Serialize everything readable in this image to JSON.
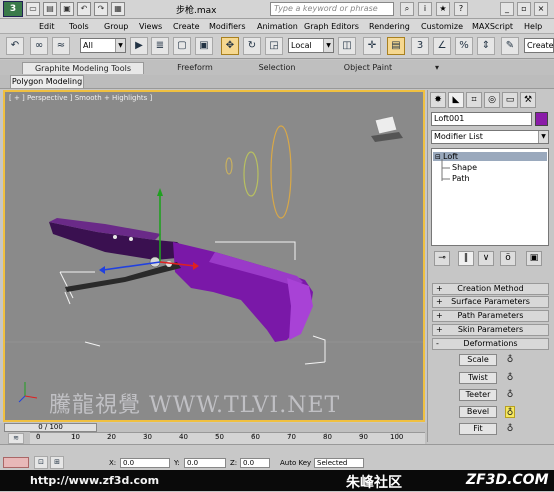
{
  "title_bar": {
    "document_title": "步枪.max",
    "search_placeholder": "Type a keyword or phrase"
  },
  "menu": [
    "Edit",
    "Tools",
    "Group",
    "Views",
    "Create",
    "Modifiers",
    "Animation",
    "Graph Editors",
    "Rendering",
    "Customize",
    "MAXScript",
    "Help"
  ],
  "toolbar": {
    "selection_filter": "All",
    "reference_coord": "Local",
    "named_selection_label": "Create"
  },
  "ribbon": {
    "tabs": [
      "Graphite Modeling Tools",
      "Freeform",
      "Selection",
      "Object Paint"
    ],
    "panel_tab": "Polygon Modeling"
  },
  "viewport": {
    "label": "[ + ] Perspective ] Smooth + Highlights ]",
    "watermark": "騰龍視覺 WWW.TLVI.NET"
  },
  "command_panel": {
    "object_name": "Loft001",
    "object_color": "#8a1ca8",
    "modifier_list": "Modifier List",
    "stack": [
      "Loft",
      "Shape",
      "Path"
    ],
    "rollouts": [
      "Creation Method",
      "Surface Parameters",
      "Path Parameters",
      "Skin Parameters",
      "Deformations"
    ],
    "deformations": [
      "Scale",
      "Twist",
      "Teeter",
      "Bevel",
      "Fit"
    ]
  },
  "timeline": {
    "slider_text": "0 / 100",
    "ticks": [
      "0",
      "10",
      "20",
      "30",
      "40",
      "50",
      "60",
      "70",
      "80",
      "90",
      "100"
    ]
  },
  "status": {
    "x_label": "X:",
    "x_value": "0.0",
    "y_label": "Y:",
    "y_value": "0.0",
    "z_label": "Z:",
    "z_value": "0.0",
    "auto_key": "Auto Key",
    "selected": "Selected"
  },
  "branding": {
    "url": "http://www.zf3d.com",
    "chinese_name": "朱峰社区",
    "site": "ZF3D.COM"
  }
}
